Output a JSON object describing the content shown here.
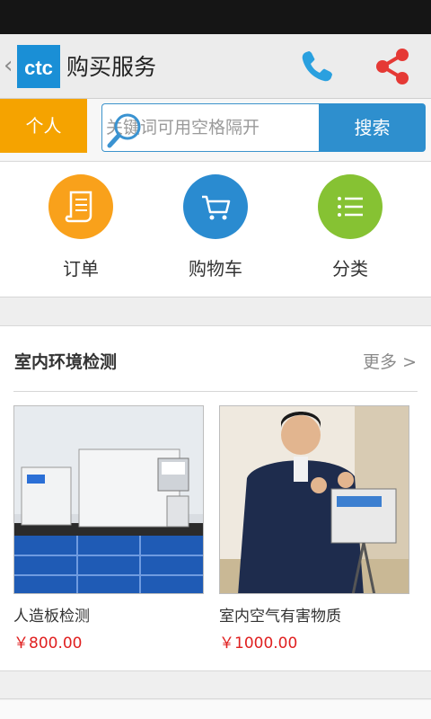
{
  "header": {
    "logo_text": "ctc",
    "title": "购买服务"
  },
  "search": {
    "tab_label": "个人",
    "placeholder": "关键词可用空格隔开",
    "button_label": "搜索"
  },
  "quick_nav": [
    {
      "label": "订单",
      "icon": "scroll-icon",
      "color": "#f9a11b"
    },
    {
      "label": "购物车",
      "icon": "cart-icon",
      "color": "#2a8bd0"
    },
    {
      "label": "分类",
      "icon": "list-icon",
      "color": "#86c233"
    }
  ],
  "section": {
    "title": "室内环境检测",
    "more_label": "更多 >",
    "products": [
      {
        "name": "人造板检测",
        "price": "￥800.00"
      },
      {
        "name": "室内空气有害物质",
        "price": "￥1000.00"
      }
    ]
  },
  "colors": {
    "accent_orange": "#f5a300",
    "accent_blue": "#2e8fce",
    "price_red": "#e02020"
  }
}
